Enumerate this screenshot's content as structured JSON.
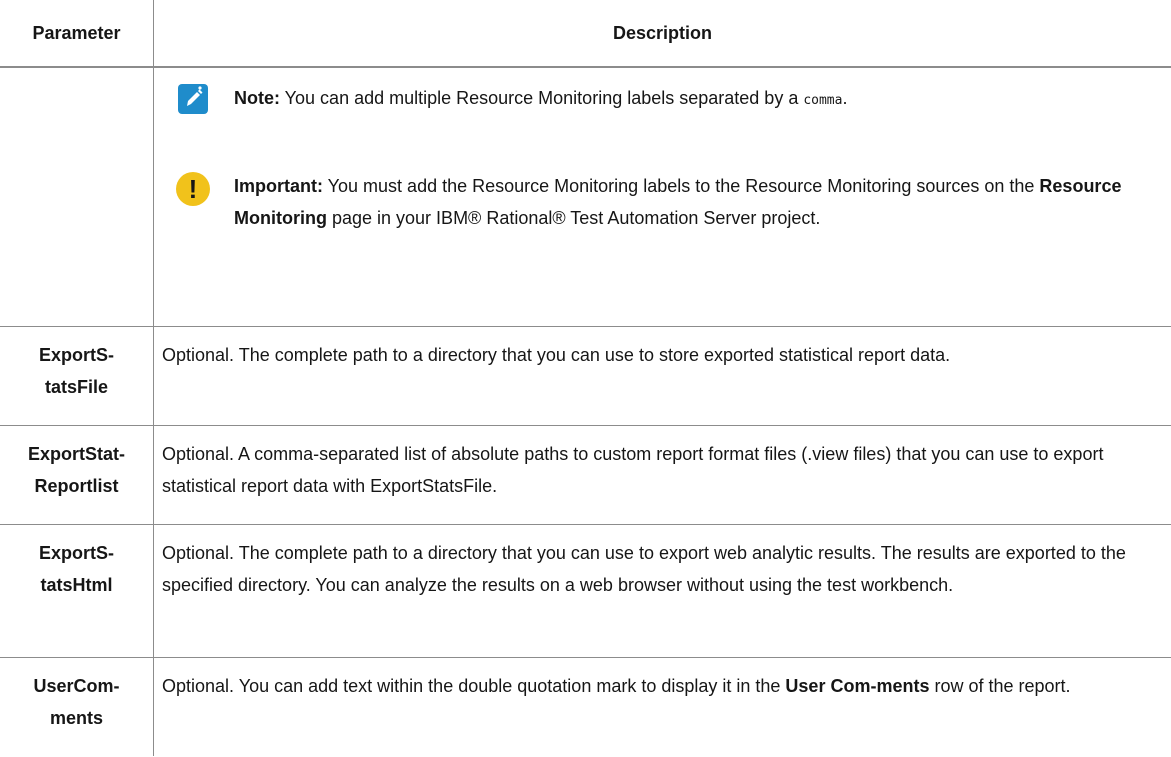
{
  "header": {
    "parameter": "Parameter",
    "description": "Description"
  },
  "notes": {
    "note_label": "Note:",
    "note_text": " You can add multiple Resource Monitoring labels separated by a ",
    "note_code": "comma",
    "note_end": ".",
    "important_label": "Important:",
    "important_text_1": " You must add the Resource Monitoring labels to the Resource Monitoring sources on the ",
    "important_bold": "Resource Monitoring",
    "important_text_2": " page in your IBM® Rational® Test Automation Server project.",
    "important_glyph": "!"
  },
  "rows": [
    {
      "param_line1": "ExportS-",
      "param_line2": "tatsFile",
      "desc": "Optional. The complete path to a directory that you can use to store exported statistical report data."
    },
    {
      "param_line1": "ExportStat-",
      "param_line2": "Reportlist",
      "desc": "Optional. A comma-separated list of absolute paths to custom report format files (.view files) that you can use to export statistical report data with ExportStatsFile."
    },
    {
      "param_line1": "ExportS-",
      "param_line2": "tatsHtml",
      "desc": "Optional. The complete path to a directory that you can use to export web analytic results. The results are exported to the specified directory. You can analyze the results on a web browser without using the test workbench."
    },
    {
      "param_line1": "UserCom-",
      "param_line2": "ments",
      "desc_a": "Optional. You can add text within the double quotation mark to display it in the ",
      "desc_bold": "User Com-ments",
      "desc_b": " row of the report."
    }
  ],
  "icons": {
    "note": "pencil-icon",
    "important": "exclamation-icon"
  },
  "colors": {
    "note_icon": "#1f8ccb",
    "important_icon": "#f1c21b",
    "border": "#8c8c8c"
  }
}
